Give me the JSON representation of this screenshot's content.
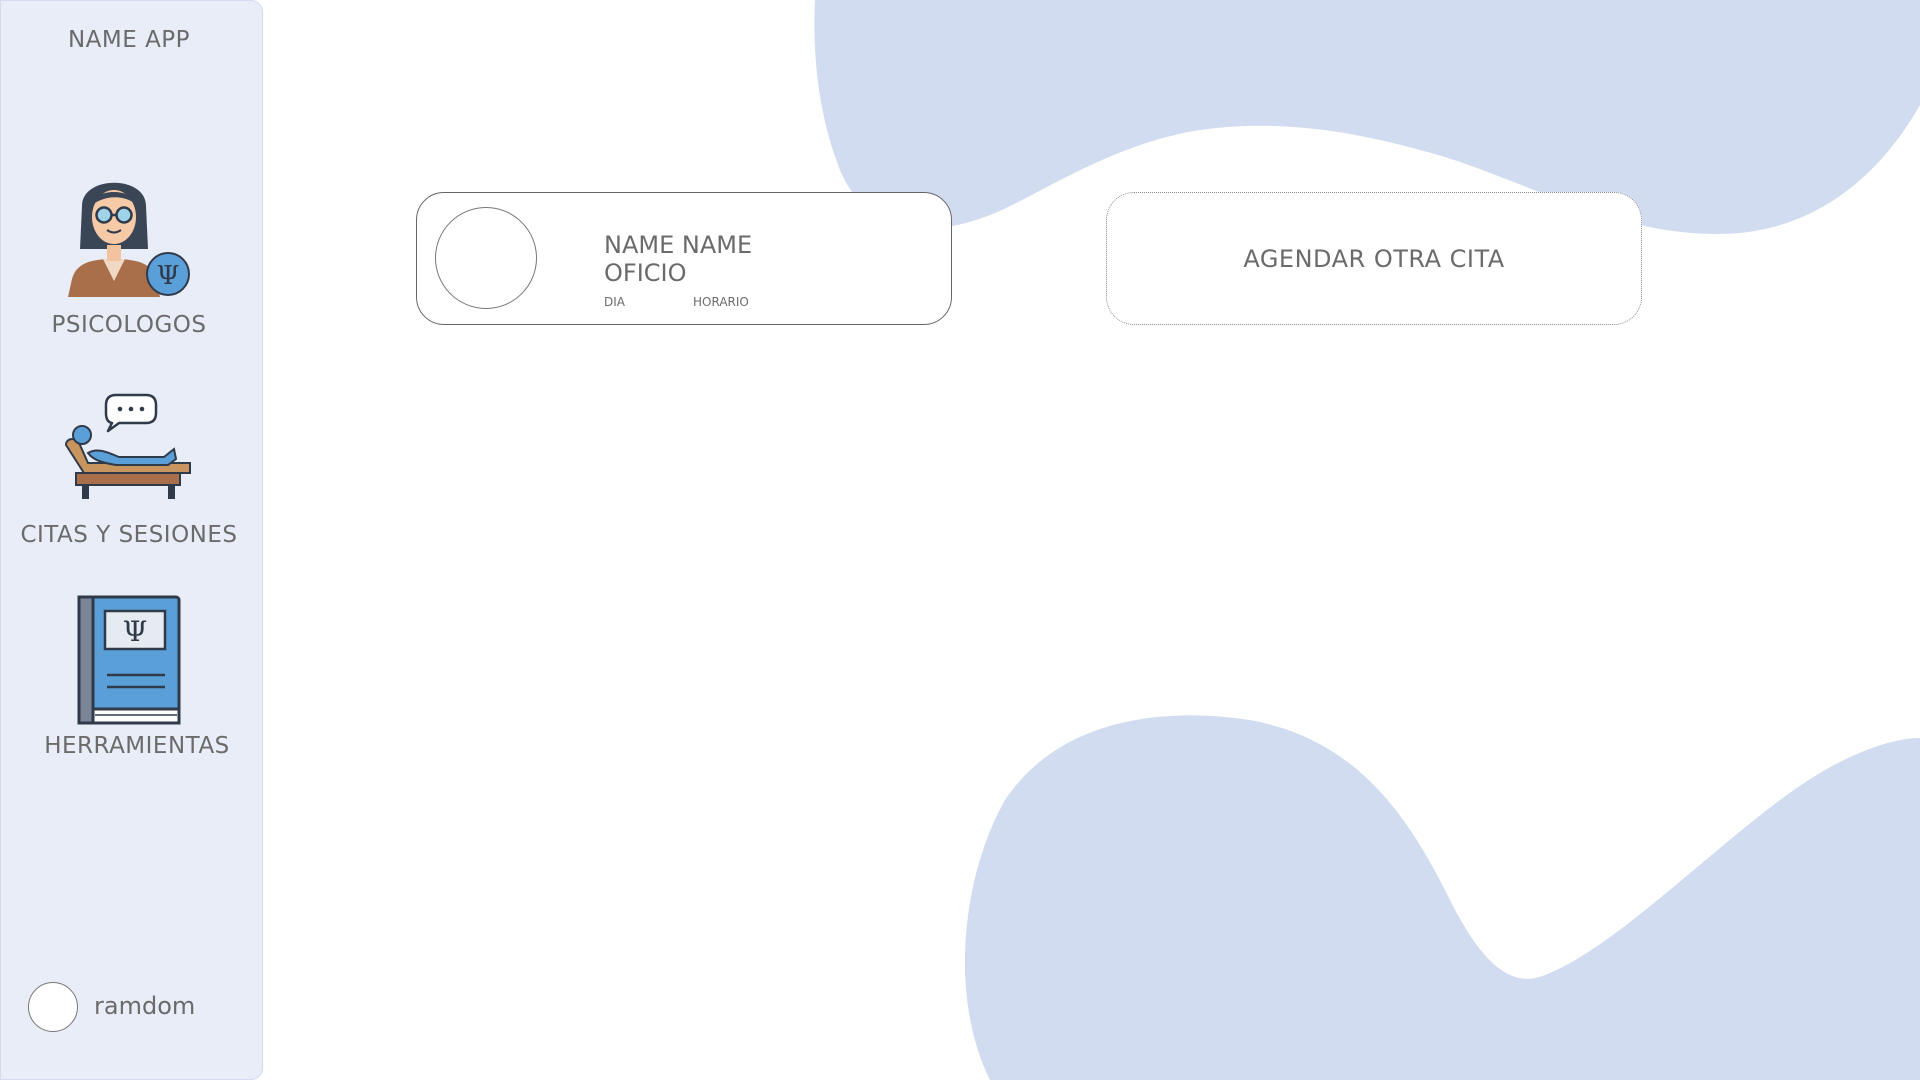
{
  "app": {
    "title": "NAME APP"
  },
  "colors": {
    "blob": "#d2dcf0",
    "sidebar_bg": "#e8edf8",
    "text": "#6b6b6b",
    "accent_blue": "#5b9fd8"
  },
  "sidebar": {
    "items": [
      {
        "label": "PSICOLOGOS",
        "icon": "psychologist-icon"
      },
      {
        "label": "CITAS Y SESIONES",
        "icon": "therapy-couch-icon"
      },
      {
        "label": "HERRAMIENTAS",
        "icon": "psychology-book-icon"
      }
    ],
    "user": {
      "name": "ramdom"
    }
  },
  "appointment": {
    "name": "NAME NAME",
    "job": "OFICIO",
    "day_label": "DIA",
    "time_label": "HORARIO"
  },
  "actions": {
    "schedule_label": "AGENDAR OTRA CITA"
  }
}
